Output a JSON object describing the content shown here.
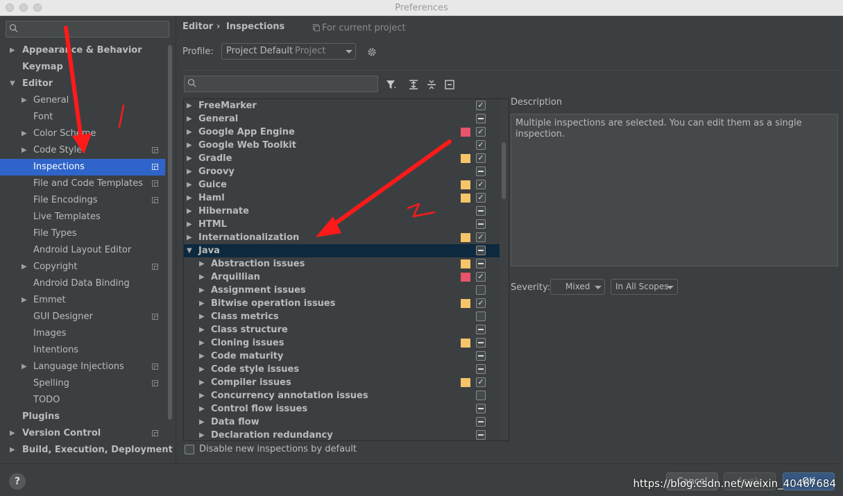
{
  "window": {
    "title": "Preferences"
  },
  "sidebar": {
    "search": {
      "placeholder": ""
    },
    "items": [
      {
        "label": "Appearance & Behavior",
        "indent": 0,
        "bold": true,
        "expander": "collapsed"
      },
      {
        "label": "Keymap",
        "indent": 0,
        "bold": true,
        "expander": "none"
      },
      {
        "label": "Editor",
        "indent": 0,
        "bold": true,
        "expander": "expanded"
      },
      {
        "label": "General",
        "indent": 1,
        "expander": "collapsed"
      },
      {
        "label": "Font",
        "indent": 1,
        "expander": "none"
      },
      {
        "label": "Color Scheme",
        "indent": 1,
        "expander": "collapsed"
      },
      {
        "label": "Code Style",
        "indent": 1,
        "expander": "collapsed",
        "project": true
      },
      {
        "label": "Inspections",
        "indent": 1,
        "expander": "none",
        "project": true,
        "selected": true
      },
      {
        "label": "File and Code Templates",
        "indent": 1,
        "expander": "none",
        "project": true
      },
      {
        "label": "File Encodings",
        "indent": 1,
        "expander": "none",
        "project": true
      },
      {
        "label": "Live Templates",
        "indent": 1,
        "expander": "none"
      },
      {
        "label": "File Types",
        "indent": 1,
        "expander": "none"
      },
      {
        "label": "Android Layout Editor",
        "indent": 1,
        "expander": "none"
      },
      {
        "label": "Copyright",
        "indent": 1,
        "expander": "collapsed",
        "project": true
      },
      {
        "label": "Android Data Binding",
        "indent": 1,
        "expander": "none"
      },
      {
        "label": "Emmet",
        "indent": 1,
        "expander": "collapsed"
      },
      {
        "label": "GUI Designer",
        "indent": 1,
        "expander": "none",
        "project": true
      },
      {
        "label": "Images",
        "indent": 1,
        "expander": "none"
      },
      {
        "label": "Intentions",
        "indent": 1,
        "expander": "none"
      },
      {
        "label": "Language Injections",
        "indent": 1,
        "expander": "collapsed",
        "project": true
      },
      {
        "label": "Spelling",
        "indent": 1,
        "expander": "none",
        "project": true
      },
      {
        "label": "TODO",
        "indent": 1,
        "expander": "none"
      },
      {
        "label": "Plugins",
        "indent": 0,
        "bold": true,
        "expander": "none"
      },
      {
        "label": "Version Control",
        "indent": 0,
        "bold": true,
        "expander": "collapsed",
        "project": true
      },
      {
        "label": "Build, Execution, Deployment",
        "indent": 0,
        "bold": true,
        "expander": "collapsed"
      }
    ]
  },
  "breadcrumb": {
    "parent": "Editor",
    "separator": "›",
    "current": "Inspections",
    "scope_note": "For current project"
  },
  "profile": {
    "label": "Profile:",
    "value": "Project Default",
    "suffix": "Project"
  },
  "inspections": {
    "search": {
      "placeholder": ""
    },
    "rows": [
      {
        "label": "FreeMarker",
        "level": 0,
        "expander": "collapsed",
        "color": "",
        "check": "checked"
      },
      {
        "label": "General",
        "level": 0,
        "expander": "collapsed",
        "color": "",
        "check": "partial"
      },
      {
        "label": "Google App Engine",
        "level": 0,
        "expander": "collapsed",
        "color": "#e8546b",
        "check": "checked"
      },
      {
        "label": "Google Web Toolkit",
        "level": 0,
        "expander": "collapsed",
        "color": "",
        "check": "checked"
      },
      {
        "label": "Gradle",
        "level": 0,
        "expander": "collapsed",
        "color": "#f6c46a",
        "check": "checked"
      },
      {
        "label": "Groovy",
        "level": 0,
        "expander": "collapsed",
        "color": "",
        "check": "partial"
      },
      {
        "label": "Guice",
        "level": 0,
        "expander": "collapsed",
        "color": "#f6c46a",
        "check": "checked"
      },
      {
        "label": "Haml",
        "level": 0,
        "expander": "collapsed",
        "color": "#f6c46a",
        "check": "checked"
      },
      {
        "label": "Hibernate",
        "level": 0,
        "expander": "collapsed",
        "color": "",
        "check": "partial"
      },
      {
        "label": "HTML",
        "level": 0,
        "expander": "collapsed",
        "color": "",
        "check": "partial"
      },
      {
        "label": "Internationalization",
        "level": 0,
        "expander": "collapsed",
        "color": "#f6c46a",
        "check": "checked"
      },
      {
        "label": "Java",
        "level": 0,
        "expander": "expanded",
        "color": "",
        "check": "partial",
        "selected": true
      },
      {
        "label": "Abstraction issues",
        "level": 1,
        "expander": "collapsed",
        "color": "#f6c46a",
        "check": "partial"
      },
      {
        "label": "Arquillian",
        "level": 1,
        "expander": "collapsed",
        "color": "#e8546b",
        "check": "checked"
      },
      {
        "label": "Assignment issues",
        "level": 1,
        "expander": "collapsed",
        "color": "",
        "check": "empty"
      },
      {
        "label": "Bitwise operation issues",
        "level": 1,
        "expander": "collapsed",
        "color": "#f6c46a",
        "check": "checked"
      },
      {
        "label": "Class metrics",
        "level": 1,
        "expander": "collapsed",
        "color": "",
        "check": "empty"
      },
      {
        "label": "Class structure",
        "level": 1,
        "expander": "collapsed",
        "color": "",
        "check": "partial"
      },
      {
        "label": "Cloning issues",
        "level": 1,
        "expander": "collapsed",
        "color": "#f6c46a",
        "check": "partial"
      },
      {
        "label": "Code maturity",
        "level": 1,
        "expander": "collapsed",
        "color": "",
        "check": "partial"
      },
      {
        "label": "Code style issues",
        "level": 1,
        "expander": "collapsed",
        "color": "",
        "check": "partial"
      },
      {
        "label": "Compiler issues",
        "level": 1,
        "expander": "collapsed",
        "color": "#f6c46a",
        "check": "checked"
      },
      {
        "label": "Concurrency annotation issues",
        "level": 1,
        "expander": "collapsed",
        "color": "",
        "check": "empty"
      },
      {
        "label": "Control flow issues",
        "level": 1,
        "expander": "collapsed",
        "color": "",
        "check": "partial"
      },
      {
        "label": "Data flow",
        "level": 1,
        "expander": "collapsed",
        "color": "",
        "check": "partial"
      },
      {
        "label": "Declaration redundancy",
        "level": 1,
        "expander": "collapsed",
        "color": "",
        "check": "partial"
      }
    ],
    "disable_new_label": "Disable new inspections by default"
  },
  "description": {
    "heading": "Description",
    "text": "Multiple inspections are selected. You can edit them as a single inspection."
  },
  "severity": {
    "label": "Severity:",
    "value": "Mixed",
    "scope": "In All Scopes"
  },
  "buttons": {
    "cancel": "Cancel",
    "apply": "Apply",
    "ok": "OK"
  },
  "watermark": "https://blog.csdn.net/weixin_40467684",
  "colors": {
    "selection": "#2f65ca",
    "tree_selection": "#0d293e",
    "warning": "#f6c46a",
    "error": "#e8546b",
    "annotation": "#ff1a1a"
  }
}
